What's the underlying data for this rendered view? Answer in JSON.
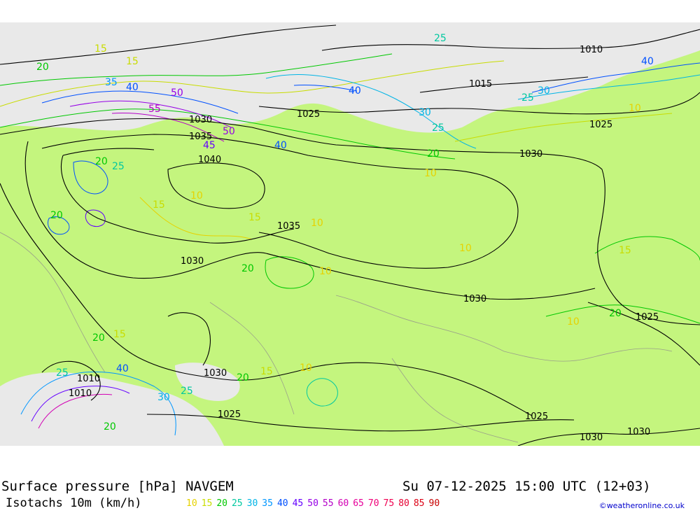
{
  "title": "Surface pressure [hPa] NAVGEM",
  "datetime": "Su 07-12-2025 15:00 UTC (12+03)",
  "legend_title": "Isotachs 10m (km/h)",
  "isotach_levels": [
    {
      "value": "10",
      "color": "#e6d200"
    },
    {
      "value": "15",
      "color": "#c8dc00"
    },
    {
      "value": "20",
      "color": "#00c800"
    },
    {
      "value": "25",
      "color": "#00c8a0"
    },
    {
      "value": "30",
      "color": "#00b4e6"
    },
    {
      "value": "35",
      "color": "#0096ff"
    },
    {
      "value": "40",
      "color": "#0050ff"
    },
    {
      "value": "45",
      "color": "#6400ff"
    },
    {
      "value": "50",
      "color": "#9600e6"
    },
    {
      "value": "55",
      "color": "#b400c8"
    },
    {
      "value": "60",
      "color": "#d200b4"
    },
    {
      "value": "65",
      "color": "#e6009a"
    },
    {
      "value": "70",
      "color": "#f00078"
    },
    {
      "value": "75",
      "color": "#f00050"
    },
    {
      "value": "80",
      "color": "#e60032"
    },
    {
      "value": "85",
      "color": "#dc0014"
    },
    {
      "value": "90",
      "color": "#c80000"
    }
  ],
  "credit": "©weatheronline.co.uk",
  "map": {
    "land_color": "#c4f57e",
    "sea_color": "#e9e9e9",
    "isobar_labels": [
      "1010",
      "1015",
      "1025",
      "1025",
      "1030",
      "1035",
      "1040",
      "1030",
      "1035",
      "1030",
      "1030",
      "1025",
      "1030",
      "1025",
      "1025",
      "1030",
      "1030",
      "1010",
      "1010"
    ],
    "isotach_labels": [
      "15",
      "15",
      "20",
      "25",
      "35",
      "40",
      "50",
      "55",
      "50",
      "45",
      "40",
      "40",
      "25",
      "20",
      "30",
      "25",
      "20",
      "10",
      "10",
      "15",
      "20",
      "10",
      "15",
      "20",
      "10",
      "10",
      "15",
      "20",
      "25",
      "40",
      "30",
      "25",
      "20",
      "10",
      "15",
      "20",
      "30",
      "40",
      "25",
      "10",
      "10",
      "15",
      "20"
    ]
  }
}
